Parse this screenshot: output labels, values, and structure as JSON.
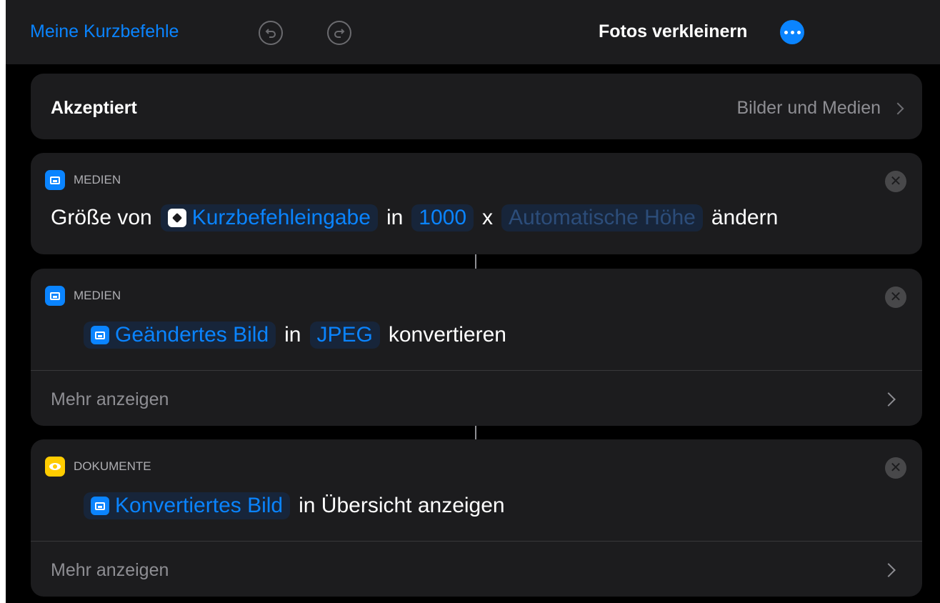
{
  "nav": {
    "back_label": "Meine Kurzbefehle",
    "title": "Fotos verkleinern",
    "undo_icon": "undo-icon",
    "redo_icon": "redo-icon",
    "more_icon": "ellipsis-icon"
  },
  "accepts": {
    "label": "Akzeptiert",
    "value": "Bilder und Medien"
  },
  "actions": [
    {
      "category": "MEDIEN",
      "prefix": "Größe von",
      "input_token": "Kurzbefehleingabe",
      "in_word": "in",
      "width_token": "1000",
      "times": "x",
      "height_token": "Automatische Höhe",
      "suffix": "ändern"
    },
    {
      "category": "MEDIEN",
      "input_token": "Geändertes Bild",
      "in_word": "in",
      "format_token": "JPEG",
      "suffix": "konvertieren",
      "more_label": "Mehr anzeigen"
    },
    {
      "category": "DOKUMENTE",
      "input_token": "Konvertiertes Bild",
      "suffix": "in Übersicht anzeigen",
      "more_label": "Mehr anzeigen"
    }
  ],
  "colors": {
    "accent": "#0a84ff",
    "card_bg": "#1c1c1e",
    "doc_icon": "#ffcc00"
  }
}
